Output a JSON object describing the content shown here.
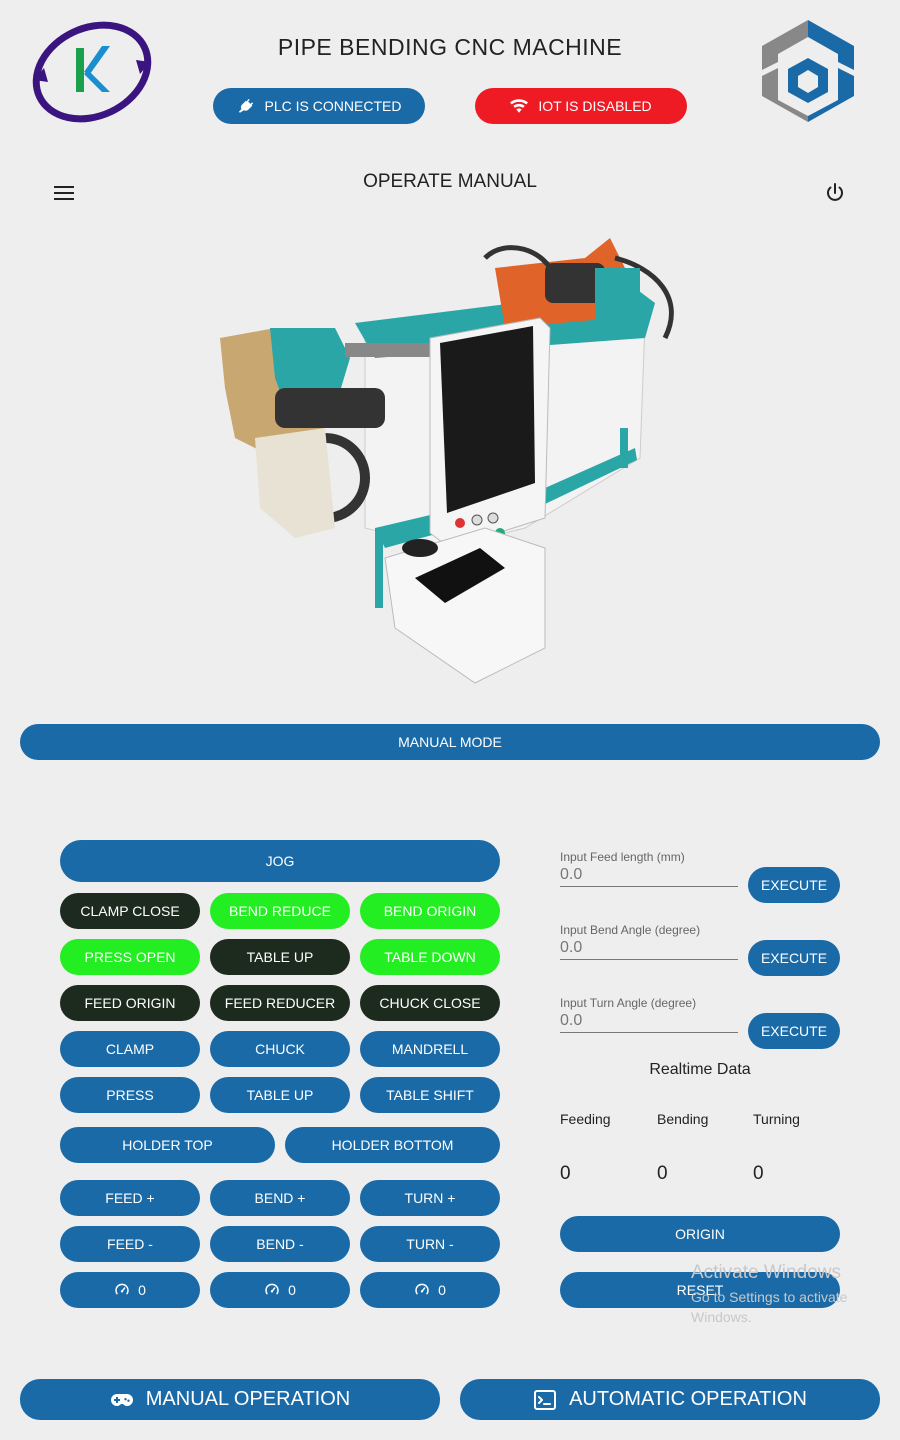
{
  "header": {
    "title": "PIPE BENDING CNC MACHINE",
    "plc_status": "PLC IS CONNECTED",
    "iot_status": "IOT IS DISABLED"
  },
  "toolbar": {
    "page_title": "OPERATE MANUAL"
  },
  "mode_label": "MANUAL MODE",
  "controls": {
    "jog": "JOG",
    "clamp_close": "CLAMP CLOSE",
    "bend_reduce": "BEND REDUCE",
    "bend_origin": "BEND ORIGIN",
    "press_open": "PRESS OPEN",
    "table_up_toggle": "TABLE UP",
    "table_down": "TABLE DOWN",
    "feed_origin": "FEED ORIGIN",
    "feed_reducer": "FEED REDUCER",
    "chuck_close": "CHUCK CLOSE",
    "clamp": "CLAMP",
    "chuck": "CHUCK",
    "mandrell": "MANDRELL",
    "press": "PRESS",
    "table_up": "TABLE UP",
    "table_shift": "TABLE SHIFT",
    "holder_top": "HOLDER TOP",
    "holder_bottom": "HOLDER BOTTOM",
    "feed_plus": "FEED +",
    "bend_plus": "BEND +",
    "turn_plus": "TURN +",
    "feed_minus": "FEED -",
    "bend_minus": "BEND -",
    "turn_minus": "TURN -",
    "speed_feed": "0",
    "speed_bend": "0",
    "speed_turn": "0"
  },
  "inputs": {
    "feed": {
      "label": "Input Feed length (mm)",
      "value": "0.0"
    },
    "bend": {
      "label": "Input Bend Angle (degree)",
      "value": "0.0"
    },
    "turn": {
      "label": "Input Turn Angle (degree)",
      "value": "0.0"
    },
    "execute_label": "EXECUTE"
  },
  "realtime": {
    "title": "Realtime Data",
    "feeding_label": "Feeding",
    "bending_label": "Bending",
    "turning_label": "Turning",
    "feeding_value": "0",
    "bending_value": "0",
    "turning_value": "0"
  },
  "actions": {
    "origin": "ORIGIN",
    "reset": "RESET"
  },
  "watermark": {
    "title": "Activate Windows",
    "subtitle": "Go to Settings to activate Windows."
  },
  "bottom_nav": {
    "manual": "MANUAL OPERATION",
    "automatic": "AUTOMATIC OPERATION"
  },
  "colors": {
    "primary": "#1a6aa8",
    "dark": "#1d2a1e",
    "active_green": "#22ee22",
    "danger": "#ee1b24",
    "background": "#eeeeee"
  },
  "icons": {
    "plc": "plug-icon",
    "iot": "wifi-icon",
    "menu": "hamburger-menu-icon",
    "power": "power-icon",
    "speed": "speedometer-icon",
    "manual": "gamepad-icon",
    "automatic": "terminal-icon"
  }
}
